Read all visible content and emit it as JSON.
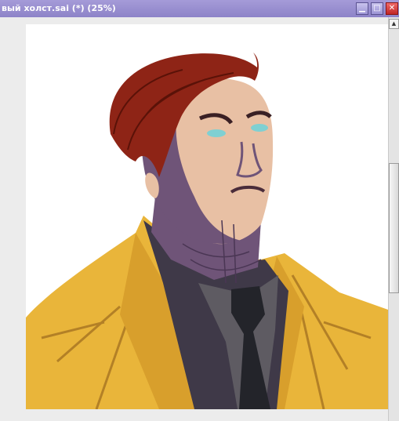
{
  "window": {
    "title": "вый холст.sai (*) (25%)",
    "controls": {
      "minimize_glyph": "▁",
      "maximize_glyph": "□",
      "close_glyph": "✕"
    }
  },
  "scrollbar": {
    "up_glyph": "▲"
  },
  "colors": {
    "titlebar": "#9a91d2",
    "coat": "#e9b53a",
    "hair": "#8e2416",
    "skin": "#e8c0a4",
    "shadow": "#6f5478",
    "shirt": "#3f3948"
  }
}
